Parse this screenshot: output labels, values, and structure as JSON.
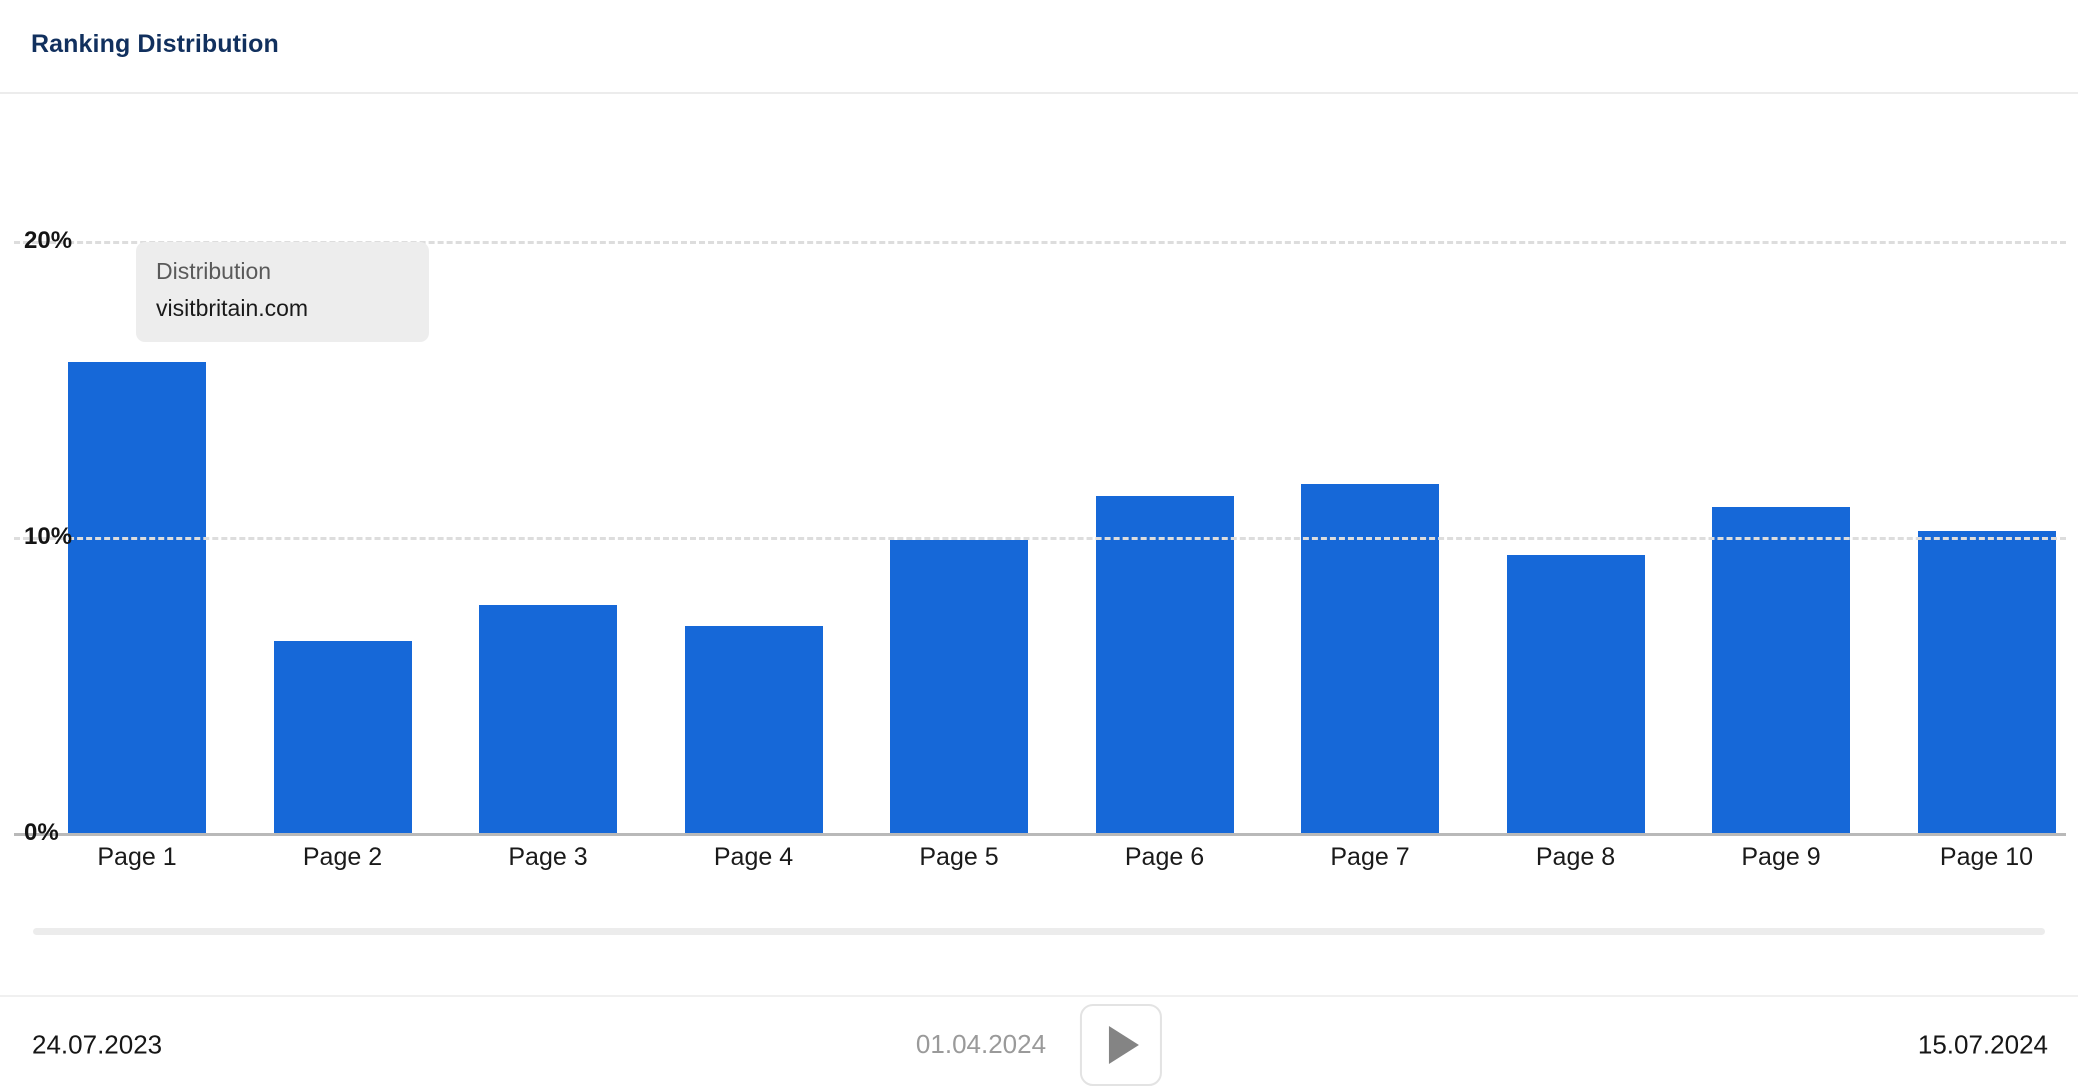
{
  "header": {
    "title": "Ranking Distribution"
  },
  "tooltip": {
    "series_label": "Distribution",
    "value_label": "visitbritain.com"
  },
  "footer": {
    "start_date": "24.07.2023",
    "current_date": "01.04.2024",
    "end_date": "15.07.2024",
    "play_icon": "play-icon"
  },
  "colors": {
    "bar": "#1668d8",
    "title": "#11305e",
    "gridline": "#dddddd",
    "axis": "#b9b9b9",
    "tooltip_bg": "#ededed",
    "play_icon": "#848484"
  },
  "chart_data": {
    "type": "bar",
    "title": "Ranking Distribution",
    "xlabel": "",
    "ylabel": "",
    "categories": [
      "Page 1",
      "Page 2",
      "Page 3",
      "Page 4",
      "Page 5",
      "Page 6",
      "Page 7",
      "Page 8",
      "Page 9",
      "Page 10"
    ],
    "values": [
      15.9,
      6.5,
      7.7,
      7.0,
      9.9,
      11.4,
      11.8,
      9.4,
      11.0,
      10.2
    ],
    "series": [
      {
        "name": "Distribution",
        "values": [
          15.9,
          6.5,
          7.7,
          7.0,
          9.9,
          11.4,
          11.8,
          9.4,
          11.0,
          10.2
        ]
      }
    ],
    "ylim": [
      0,
      20
    ],
    "yticks": [
      0,
      10,
      20
    ],
    "ytick_labels": [
      "0%",
      "10%",
      "20%"
    ],
    "grid": true,
    "legend": "none",
    "unit": "%"
  }
}
